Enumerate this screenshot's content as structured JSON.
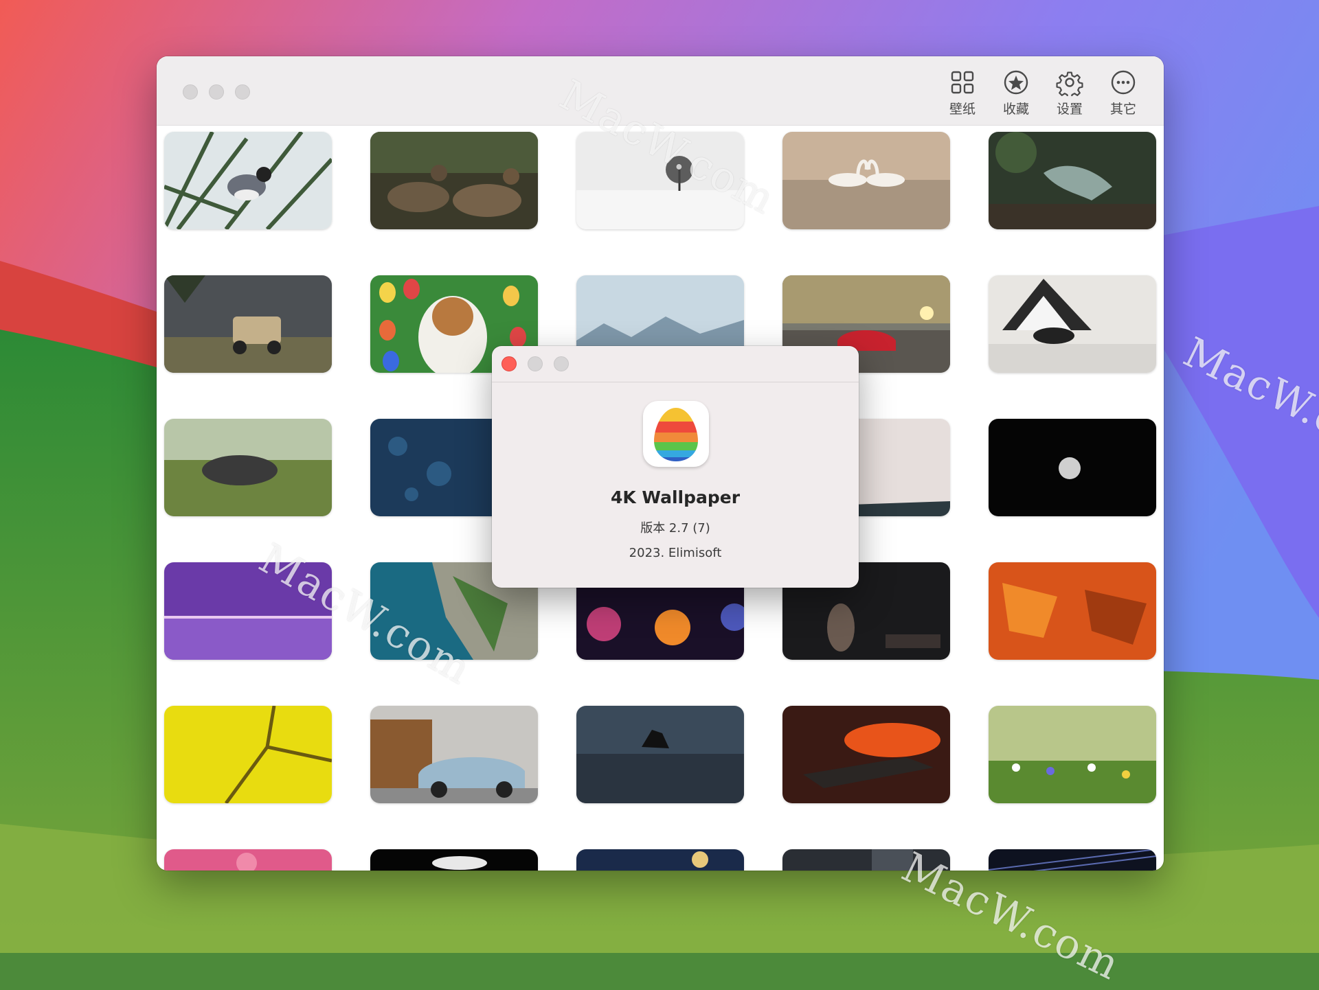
{
  "toolbar": {
    "items": [
      {
        "label": "壁纸",
        "icon": "grid-icon"
      },
      {
        "label": "收藏",
        "icon": "star-circle-icon"
      },
      {
        "label": "设置",
        "icon": "gear-icon"
      },
      {
        "label": "其它",
        "icon": "ellipsis-circle-icon"
      }
    ]
  },
  "about": {
    "app_name": "4K Wallpaper",
    "version": "版本 2.7 (7)",
    "copyright": "2023. Elimisoft"
  },
  "watermark": "MacW.com",
  "wallpapers": [
    "bird-on-reeds",
    "deer-in-forest",
    "lone-tree-in-fog",
    "swans-heart",
    "iguana",
    "armored-vehicle",
    "dog-with-easter-eggs",
    "misty-mountains",
    "red-sports-car-sunset",
    "dog-in-teepee",
    "seal-on-grass",
    "blue-water-drops",
    "snowy-treeline",
    "moon-night-sky",
    "purple-sunset-lake",
    "aerial-karst-lagoon",
    "bokeh-lights",
    "girl-on-rooftop",
    "orange-abstract-painting",
    "yellow-cells-macro",
    "blue-suv-storefront",
    "sea-stack-long-exposure",
    "jet-fighter-sunset",
    "wildflower-meadow",
    "pink-flowers",
    "dark-silhouette",
    "night-city-lights",
    "dark-city",
    "star-trails"
  ],
  "colors": {
    "close_button": "#fe5f57",
    "titlebar": "#efedee",
    "dialog": "#f1eced"
  }
}
